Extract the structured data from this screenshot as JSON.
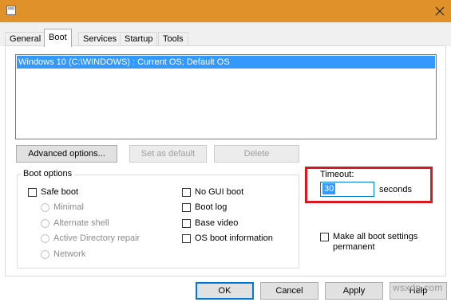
{
  "window": {
    "close_glyph": "✕"
  },
  "tabs": [
    {
      "label": "General",
      "active": false
    },
    {
      "label": "Boot",
      "active": true
    },
    {
      "label": "Services",
      "active": false
    },
    {
      "label": "Startup",
      "active": false
    },
    {
      "label": "Tools",
      "active": false
    }
  ],
  "os_list": {
    "items": [
      {
        "label": "Windows 10 (C:\\WINDOWS) : Current OS; Default OS",
        "selected": true
      }
    ]
  },
  "list_buttons": {
    "advanced": "Advanced options...",
    "set_default": "Set as default",
    "delete": "Delete"
  },
  "boot_options": {
    "title": "Boot options",
    "safe_boot": {
      "label": "Safe boot",
      "checked": false
    },
    "safe_boot_modes": [
      {
        "label": "Minimal"
      },
      {
        "label": "Alternate shell"
      },
      {
        "label": "Active Directory repair"
      },
      {
        "label": "Network"
      }
    ],
    "no_gui_boot": {
      "label": "No GUI boot",
      "checked": false
    },
    "boot_log": {
      "label": "Boot log",
      "checked": false
    },
    "base_video": {
      "label": "Base video",
      "checked": false
    },
    "os_boot_information": {
      "label": "OS boot information",
      "checked": false
    }
  },
  "timeout": {
    "label": "Timeout:",
    "value": "30",
    "unit": "seconds",
    "highlight_color": "#d71920"
  },
  "make_permanent": {
    "label": "Make all boot settings permanent",
    "checked": false
  },
  "footer_buttons": {
    "ok": "OK",
    "cancel": "Cancel",
    "apply": "Apply",
    "help": "Help"
  },
  "watermark": "wsxdn.com",
  "colors": {
    "titlebar": "#e0912a",
    "selection": "#3399ff",
    "focus": "#0078d7"
  }
}
